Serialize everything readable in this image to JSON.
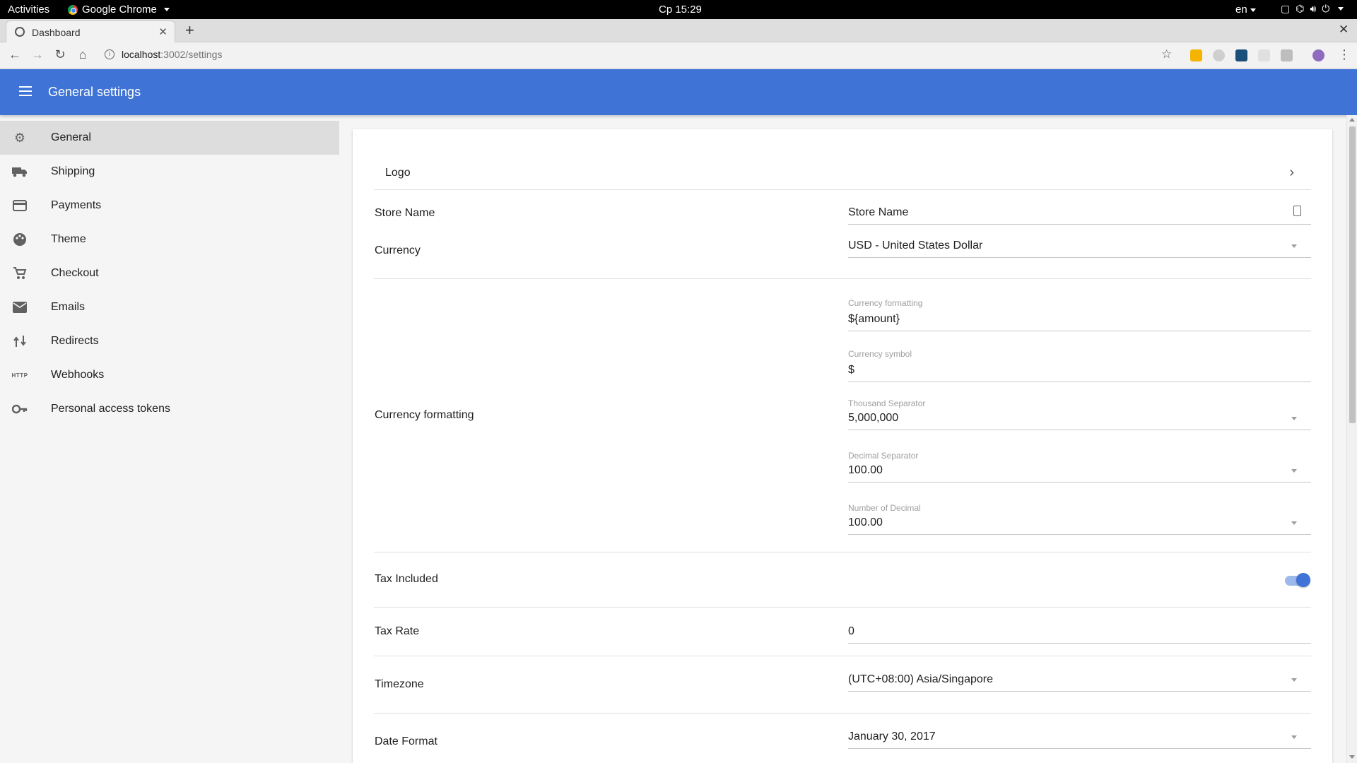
{
  "os_bar": {
    "activities": "Activities",
    "app_name": "Google Chrome",
    "clock": "Ср 15:29",
    "language": "en"
  },
  "browser": {
    "tab_title": "Dashboard",
    "url_host": "localhost",
    "url_path": ":3002/settings",
    "new_tab": "+",
    "close_window": "✕",
    "tab_close": "✕"
  },
  "appbar": {
    "title": "General settings"
  },
  "sidebar": {
    "items": [
      {
        "label": "General",
        "icon": "gear-icon",
        "active": true
      },
      {
        "label": "Shipping",
        "icon": "truck-icon",
        "active": false
      },
      {
        "label": "Payments",
        "icon": "credit-card-icon",
        "active": false
      },
      {
        "label": "Theme",
        "icon": "palette-icon",
        "active": false
      },
      {
        "label": "Checkout",
        "icon": "cart-icon",
        "active": false
      },
      {
        "label": "Emails",
        "icon": "mail-icon",
        "active": false
      },
      {
        "label": "Redirects",
        "icon": "redirect-icon",
        "active": false
      },
      {
        "label": "Webhooks",
        "icon": "http-icon",
        "active": false
      },
      {
        "label": "Personal access tokens",
        "icon": "key-icon",
        "active": false
      }
    ],
    "http_text": "HTTP"
  },
  "settings": {
    "logo_label": "Logo",
    "store_name_label": "Store Name",
    "store_name_value": "Store Name",
    "currency_label": "Currency",
    "currency_value": "USD - United States Dollar",
    "currency_formatting_label": "Currency formatting",
    "currency_formatting_field_label": "Currency formatting",
    "currency_formatting_value": "${amount}",
    "currency_symbol_label": "Currency symbol",
    "currency_symbol_value": "$",
    "thousand_separator_label": "Thousand Separator",
    "thousand_separator_value": "5,000,000",
    "decimal_separator_label": "Decimal Separator",
    "decimal_separator_value": "100.00",
    "number_of_decimal_label": "Number of Decimal",
    "number_of_decimal_value": "100.00",
    "tax_included_label": "Tax Included",
    "tax_included_value": true,
    "tax_rate_label": "Tax Rate",
    "tax_rate_value": "0",
    "timezone_label": "Timezone",
    "timezone_value": "(UTC+08:00) Asia/Singapore",
    "date_format_label": "Date Format",
    "date_format_value": "January 30, 2017"
  },
  "colors": {
    "appbar": "#3f74d6",
    "active_nav": "#dddddd",
    "toggle_on": "#3f74d6"
  }
}
